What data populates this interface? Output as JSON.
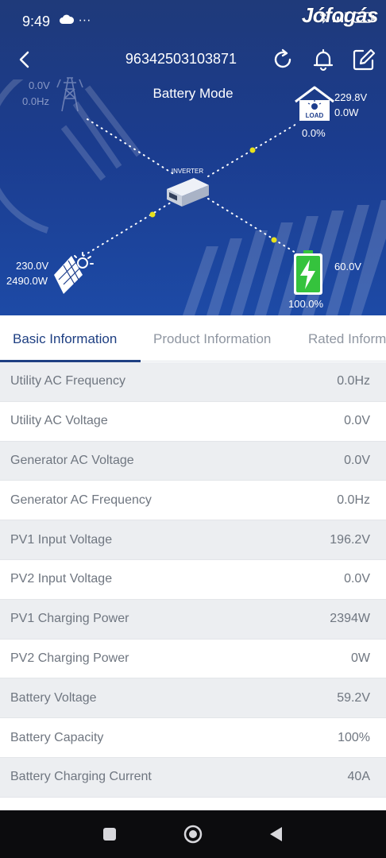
{
  "status_bar": {
    "time": "9:49",
    "dots": "···",
    "watermark": "Jófogás"
  },
  "navbar": {
    "device_id": "96342503103871"
  },
  "mode": "Battery Mode",
  "grid": {
    "voltage": "0.0V",
    "frequency": "0.0Hz"
  },
  "load": {
    "voltage": "229.8V",
    "power": "0.0W",
    "percent": "0.0%",
    "icon_label": "LOAD"
  },
  "inverter": {
    "label": "INVERTER"
  },
  "solar": {
    "voltage": "230.0V",
    "power": "2490.0W"
  },
  "battery": {
    "voltage": "60.0V",
    "percent": "100.0%"
  },
  "tabs": [
    {
      "label": "Basic Information",
      "active": true
    },
    {
      "label": "Product Information",
      "active": false
    },
    {
      "label": "Rated Information",
      "active": false
    }
  ],
  "rows": [
    {
      "label": "Utility AC Frequency",
      "value": "0.0Hz"
    },
    {
      "label": "Utility AC Voltage",
      "value": "0.0V"
    },
    {
      "label": "Generator AC Voltage",
      "value": "0.0V"
    },
    {
      "label": "Generator AC Frequency",
      "value": "0.0Hz"
    },
    {
      "label": "PV1 Input Voltage",
      "value": "196.2V"
    },
    {
      "label": "PV2 Input Voltage",
      "value": "0.0V"
    },
    {
      "label": "PV1 Charging Power",
      "value": "2394W"
    },
    {
      "label": "PV2 Charging Power",
      "value": "0W"
    },
    {
      "label": "Battery Voltage",
      "value": "59.2V"
    },
    {
      "label": "Battery Capacity",
      "value": "100%"
    },
    {
      "label": "Battery Charging Current",
      "value": "40A"
    }
  ],
  "colors": {
    "header_bg": "#1d3d8c",
    "accent": "#1e3f82",
    "flow_dot": "#e8e21c",
    "battery_green": "#35c33d"
  },
  "icons": [
    "back-icon",
    "refresh-icon",
    "bell-icon",
    "edit-icon",
    "tower-icon",
    "house-icon",
    "inverter-icon",
    "solar-panel-icon",
    "battery-icon",
    "home-nav-icon",
    "recents-nav-icon",
    "back-nav-icon"
  ]
}
